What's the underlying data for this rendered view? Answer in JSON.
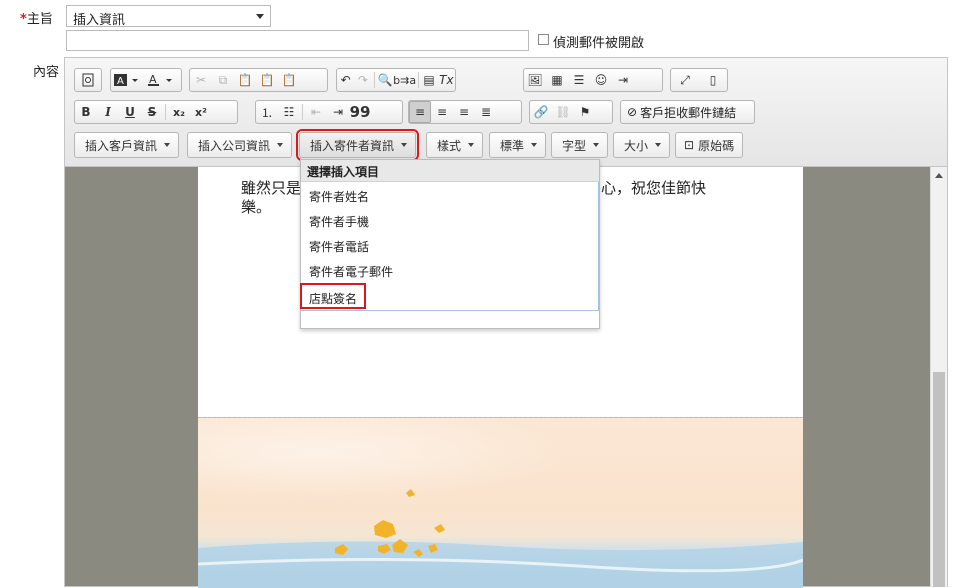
{
  "form": {
    "subject_star": "*",
    "subject_label": "主旨",
    "subject_select_value": "插入資訊",
    "subject_input_value": "",
    "track_open_label": "偵測郵件被開啟",
    "content_label": "內容"
  },
  "toolbar": {
    "dropdowns": [
      "插入客戶資訊",
      "插入公司資訊",
      "插入寄件者資訊",
      "樣式",
      "標準",
      "字型",
      "大小"
    ],
    "source_label": "原始碼",
    "unsubscribe_label": "客戶拒收郵件鏈結",
    "bold": "B",
    "italic": "I",
    "underline": "U",
    "strike": "S",
    "quote": "99"
  },
  "editor": {
    "body_left": "雖然只是",
    "body_right": "的關心，祝您佳節快",
    "body_line2": "樂。"
  },
  "menu": {
    "header": "選擇插入項目",
    "items": [
      "寄件者姓名",
      "寄件者手機",
      "寄件者電話",
      "寄件者電子郵件",
      "店點簽名"
    ]
  },
  "colors": {
    "required": "#d9191c",
    "highlight": "#d9191c",
    "editor_bg": "#8a8a80"
  }
}
